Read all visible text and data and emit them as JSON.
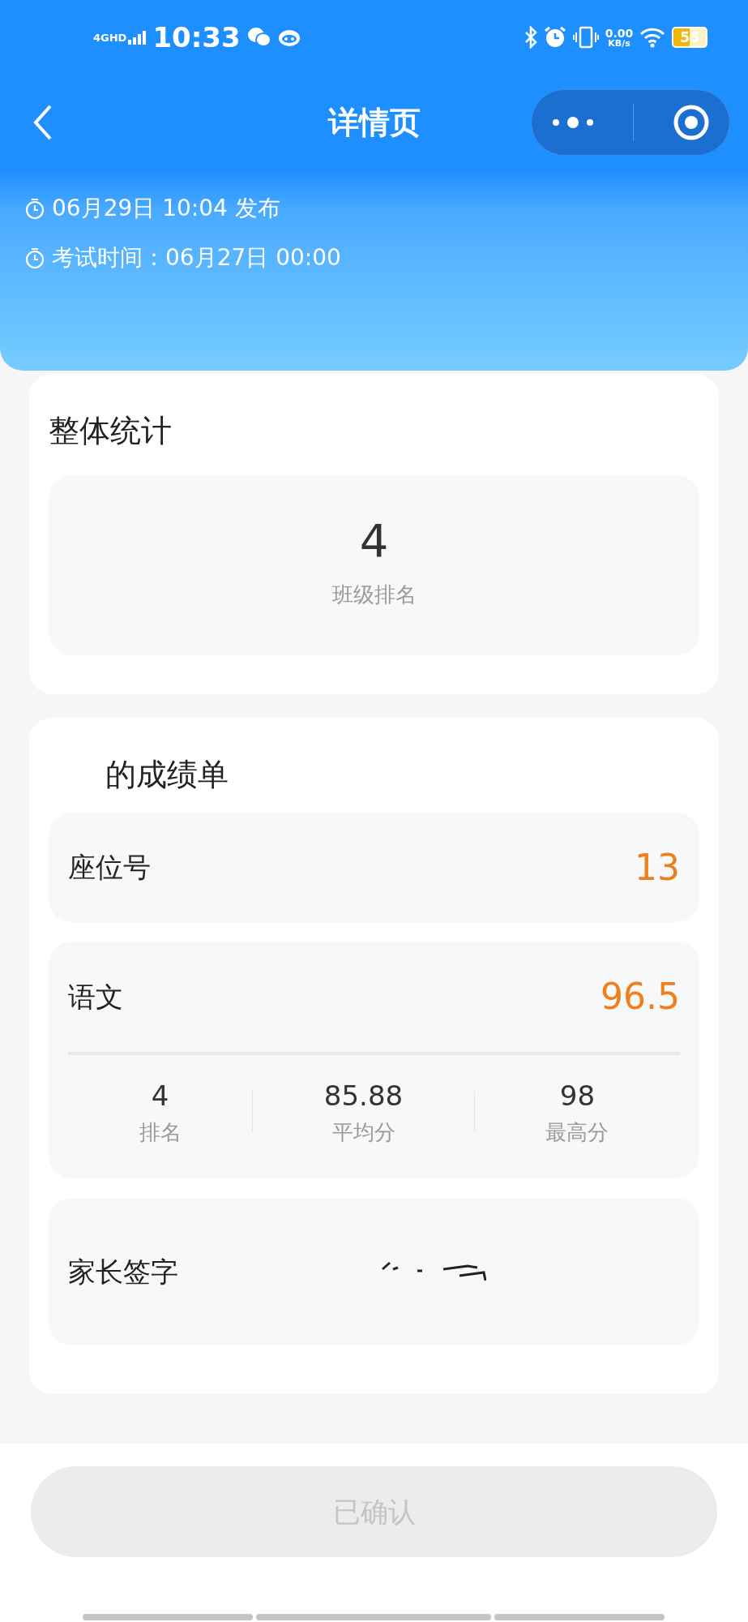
{
  "status_bar": {
    "network": "4GHD",
    "time": "10:33",
    "speed": "0.00",
    "speed_unit": "KB/s",
    "battery": "55"
  },
  "nav_bar": {
    "title": "详情页"
  },
  "info": [
    {
      "text": "06月29日 10:04 发布"
    },
    {
      "text": "考试时间：06月27日 00:00"
    }
  ],
  "overall": {
    "title": "整体统计",
    "value": "4",
    "label": "班级排名"
  },
  "report": {
    "title": "的成绩单",
    "seat": {
      "label": "座位号",
      "value": "13"
    },
    "subject": {
      "label": "语文",
      "value": "96.5",
      "stats": [
        {
          "value": "4",
          "label": "排名"
        },
        {
          "value": "85.88",
          "label": "平均分"
        },
        {
          "value": "98",
          "label": "最高分"
        }
      ]
    },
    "signature": {
      "label": "家长签字"
    }
  },
  "confirm_button": {
    "label": "已确认",
    "disabled": true
  }
}
